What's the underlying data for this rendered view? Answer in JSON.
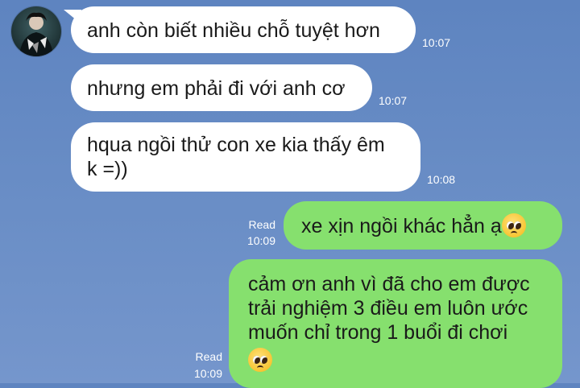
{
  "messages": [
    {
      "text": "anh còn biết nhiều chỗ tuyệt hơn",
      "time": "10:07"
    },
    {
      "text": "nhưng em phải đi với anh cơ",
      "time": "10:07"
    },
    {
      "text": "hqua ngồi thử con xe kia thấy êm",
      "text2": "k =))",
      "time": "10:08"
    },
    {
      "text": "xe xịn ngồi khác hẳn ạ",
      "emoji": "pleading-face-icon",
      "status": "Read",
      "time": "10:09"
    },
    {
      "lines": [
        "cảm ơn anh vì đã cho em được",
        "trải nghiệm 3 điều em luôn ước",
        "muốn chỉ trong 1 buổi đi chơi"
      ],
      "emoji": "pleading-face-icon",
      "status": "Read",
      "time": "10:09"
    }
  ],
  "colors": {
    "background": "#6a8ec6",
    "incoming_bubble": "#ffffff",
    "outgoing_bubble": "#86e06e",
    "meta_text": "#ffffff"
  }
}
